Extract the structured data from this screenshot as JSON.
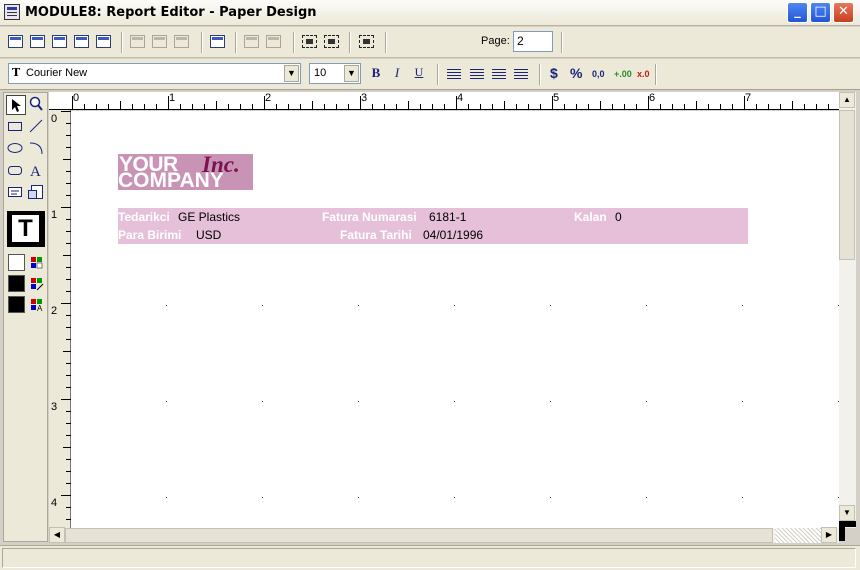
{
  "window": {
    "title": "MODULE8: Report Editor - Paper Design",
    "controls": [
      "minimize",
      "maximize",
      "close"
    ]
  },
  "toolbar": {
    "icons": [
      "report-properties-icon",
      "data-source-icon",
      "edit-fields-icon",
      "preview-icon",
      "print-preview-icon",
      "insert-band-above-icon",
      "insert-band-below-icon",
      "delete-band-icon",
      "bring-forward-icon",
      "align-left-objects-icon",
      "align-right-objects-icon",
      "select-frame-icon",
      "resize-frame-icon",
      "group-frame-icon",
      "first-page-icon",
      "prev-page-icon",
      "next-page-icon",
      "last-page-icon"
    ],
    "page_label": "Page:",
    "page_value": "2"
  },
  "format": {
    "font_name": "Courier New",
    "font_size": "10",
    "bold": "B",
    "italic": "I",
    "underline": "U",
    "currency": "$",
    "percent": "%",
    "decimal": "0,0",
    "add_decimal": "+.00",
    "remove_decimal": "x.0"
  },
  "ruler": {
    "horizontal": [
      "0",
      "1",
      "2",
      "3",
      "4",
      "5",
      "6",
      "7"
    ],
    "vertical": [
      "0",
      "1",
      "2",
      "3",
      "4"
    ]
  },
  "report": {
    "logo_top": "YOUR",
    "logo_inc": "Inc.",
    "logo_bottom": "COMPANY",
    "fields": {
      "supplier_label": "Tedarikci",
      "supplier_value": "GE Plastics",
      "invoice_no_label": "Fatura Numarasi",
      "invoice_no_value": "6181-1",
      "balance_label": "Kalan",
      "balance_value": "0",
      "currency_label": "Para Birimi",
      "currency_value": "USD",
      "invoice_date_label": "Fatura Tarihi",
      "invoice_date_value": "04/01/1996"
    },
    "colors": {
      "logo_bg": "#c993b6",
      "logo_accent": "#7a1350",
      "band_bg": "#e6c0d8"
    }
  },
  "palette": {
    "tools": [
      "pointer-icon",
      "zoom-icon",
      "rectangle-icon",
      "line-icon",
      "ellipse-icon",
      "arc-icon",
      "rounded-rect-icon",
      "text-icon",
      "field-icon",
      "image-icon"
    ],
    "fill_color": "#ffffff",
    "line_color": "#000000",
    "text_color": "#000000"
  }
}
